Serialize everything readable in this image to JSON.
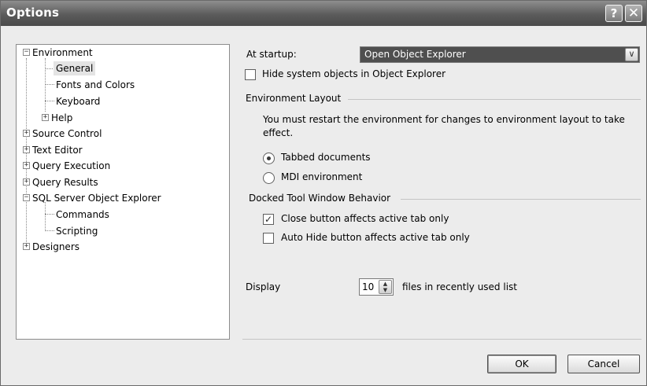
{
  "window": {
    "title": "Options",
    "help_glyph": "?",
    "close_glyph": "✕"
  },
  "tree": {
    "items": [
      {
        "label": "Environment",
        "expander": "−"
      },
      {
        "label": "General"
      },
      {
        "label": "Fonts and Colors"
      },
      {
        "label": "Keyboard"
      },
      {
        "label": "Help",
        "expander": "+"
      },
      {
        "label": "Source Control",
        "expander": "+"
      },
      {
        "label": "Text Editor",
        "expander": "+"
      },
      {
        "label": "Query Execution",
        "expander": "+"
      },
      {
        "label": "Query Results",
        "expander": "+"
      },
      {
        "label": "SQL Server Object Explorer",
        "expander": "−"
      },
      {
        "label": "Commands"
      },
      {
        "label": "Scripting"
      },
      {
        "label": "Designers",
        "expander": "+"
      }
    ]
  },
  "general": {
    "at_startup_label": "At startup:",
    "at_startup_value": "Open Object Explorer",
    "hide_system_objects": {
      "label": "Hide system objects in Object Explorer",
      "checked": false
    }
  },
  "environment_layout": {
    "heading": "Environment Layout",
    "note": "You must restart the environment for changes to environment layout to take effect.",
    "options": [
      {
        "label": "Tabbed documents",
        "selected": true
      },
      {
        "label": "MDI environment",
        "selected": false
      }
    ]
  },
  "docked_tool_window": {
    "heading": "Docked Tool Window Behavior",
    "close_button_label": "Close button affects active tab only",
    "close_button_checked": true,
    "auto_hide_label": "Auto Hide button affects active tab only",
    "auto_hide_checked": false
  },
  "recent_files": {
    "display_label": "Display",
    "count": "10",
    "suffix": "files in recently used list"
  },
  "buttons": {
    "ok": "OK",
    "cancel": "Cancel"
  }
}
